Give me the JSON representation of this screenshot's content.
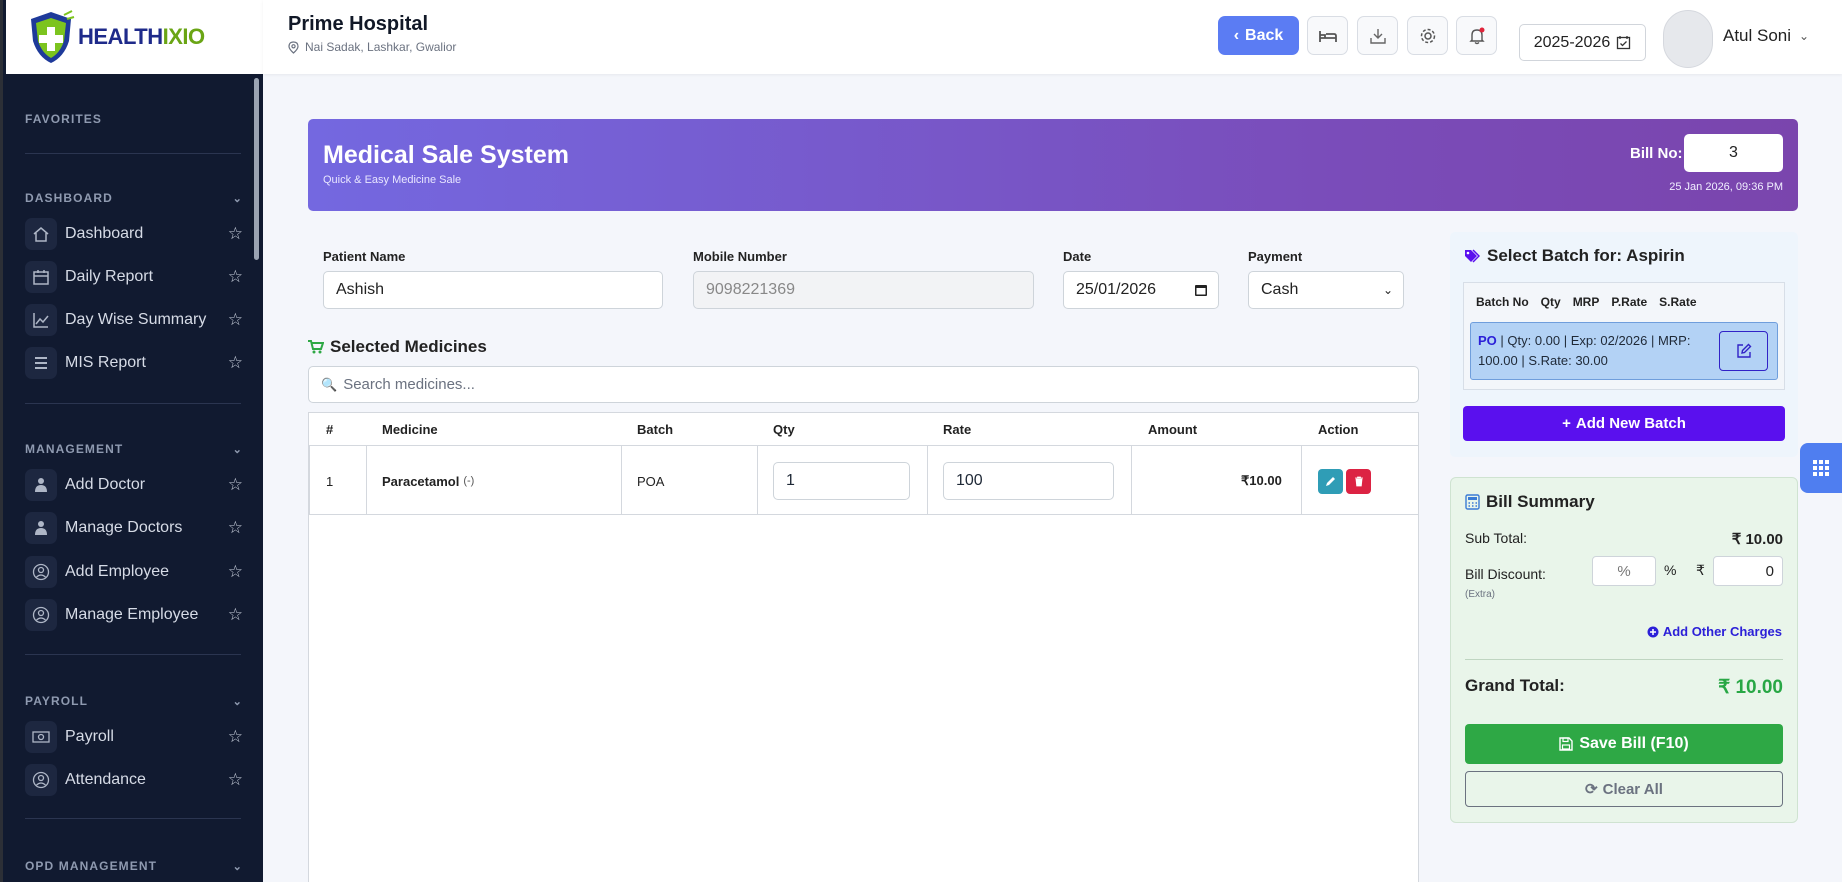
{
  "brand": {
    "logo_part1": "HEALTH",
    "logo_part2": "IXIO"
  },
  "sidebar": {
    "sections": [
      {
        "title": "FAVORITES"
      },
      {
        "title": "DASHBOARD"
      },
      {
        "title": "MANAGEMENT"
      },
      {
        "title": "PAYROLL"
      },
      {
        "title": "OPD MANAGEMENT"
      }
    ],
    "items": [
      {
        "label": "Dashboard",
        "icon": "home-icon"
      },
      {
        "label": "Daily Report",
        "icon": "calendar-icon"
      },
      {
        "label": "Day Wise Summary",
        "icon": "chart-line-icon"
      },
      {
        "label": "MIS Report",
        "icon": "list-icon"
      },
      {
        "label": "Add Doctor",
        "icon": "doctor-icon"
      },
      {
        "label": "Manage Doctors",
        "icon": "doctor-icon"
      },
      {
        "label": "Add Employee",
        "icon": "user-circle-icon"
      },
      {
        "label": "Manage Employee",
        "icon": "user-circle-icon"
      },
      {
        "label": "Payroll",
        "icon": "money-icon"
      },
      {
        "label": "Attendance",
        "icon": "user-circle-icon"
      }
    ]
  },
  "header": {
    "hospital_name": "Prime Hospital",
    "address": "Nai Sadak, Lashkar, Gwalior",
    "back_label": "Back",
    "year": "2025-2026",
    "user_name": "Atul Soni"
  },
  "hero": {
    "title": "Medical Sale System",
    "subtitle": "Quick & Easy Medicine Sale",
    "bill_label": "Bill No:",
    "bill_no": "3",
    "datetime": "25 Jan 2026, 09:36 PM"
  },
  "form": {
    "patient_label": "Patient Name",
    "patient_value": "Ashish",
    "mobile_label": "Mobile Number",
    "mobile_placeholder": "9098221369",
    "date_label": "Date",
    "date_value": "25/01/2026",
    "payment_label": "Payment",
    "payment_value": "Cash"
  },
  "medicines": {
    "title": "Selected Medicines",
    "search_placeholder": "Search medicines...",
    "columns": [
      "#",
      "Medicine",
      "Batch",
      "Qty",
      "Rate",
      "Amount",
      "Action"
    ],
    "rows": [
      {
        "index": "1",
        "name": "Paracetamol",
        "suffix": "(-)",
        "batch": "POA",
        "qty": "1",
        "rate": "100",
        "amount": "₹10.00"
      }
    ]
  },
  "batch": {
    "title": "Select Batch for: Aspirin",
    "columns": [
      "Batch No",
      "Qty",
      "MRP",
      "P.Rate",
      "S.Rate"
    ],
    "entry": {
      "code": "PO",
      "details": " | Qty: 0.00 | Exp: 02/2026 | MRP: 100.00 | S.Rate: 30.00"
    },
    "add_label": "Add New Batch"
  },
  "summary": {
    "title": "Bill Summary",
    "subtotal_label": "Sub Total:",
    "subtotal_value": "₹ 10.00",
    "discount_label": "Bill Discount:",
    "discount_note": "(Extra)",
    "discount_pct_placeholder": "%",
    "pct_symbol": "%",
    "rupee_symbol": "₹",
    "discount_amount": "0",
    "other_charges": "Add Other Charges",
    "grand_label": "Grand Total:",
    "grand_value": "₹ 10.00",
    "save_label": "Save Bill (F10)",
    "clear_label": "Clear All"
  }
}
